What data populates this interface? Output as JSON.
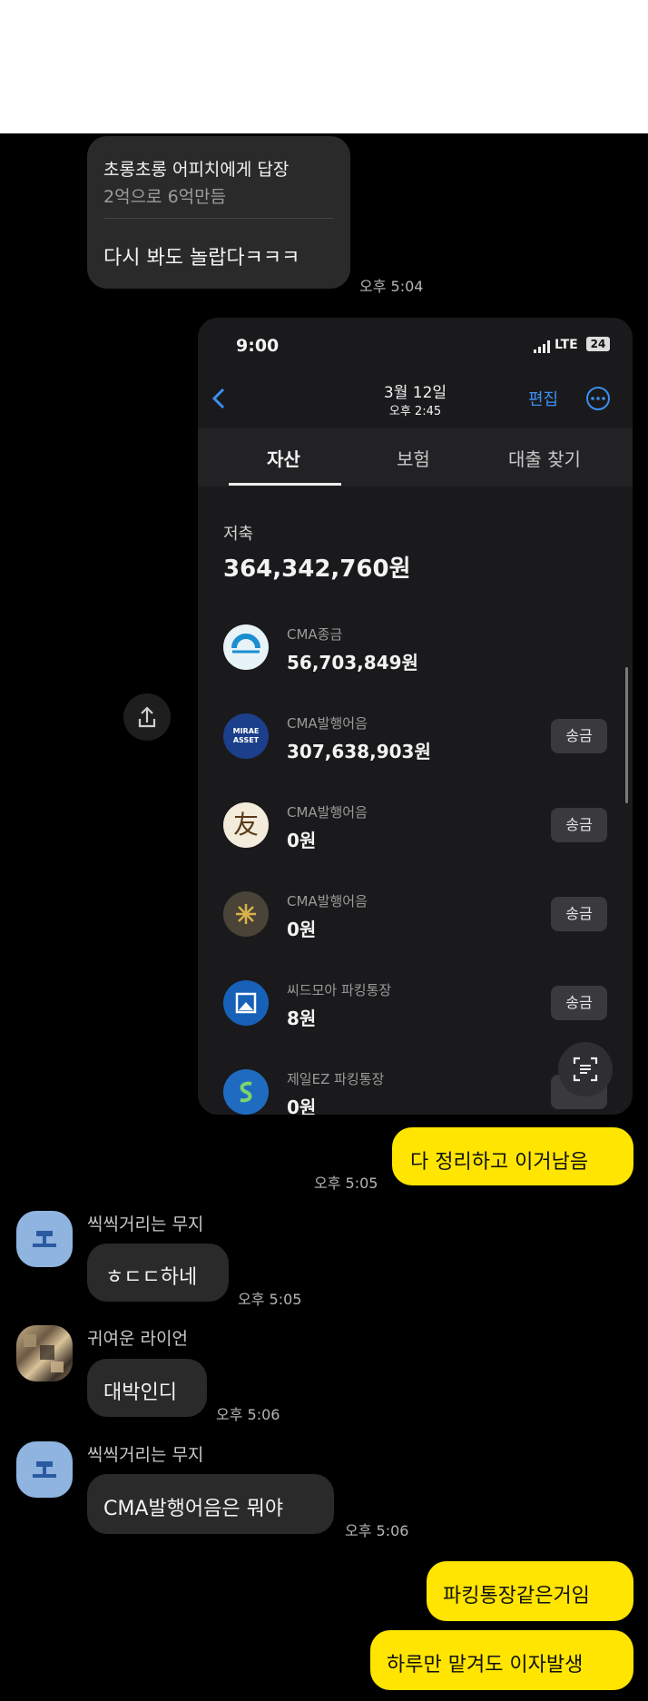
{
  "messages": {
    "reply": {
      "title": "초롱초롱 어피치에게 답장",
      "quote": "2억으로 6억만듬",
      "text": "다시 봐도 놀랍다ㅋㅋㅋ",
      "time": "오후 5:04"
    },
    "mine1": {
      "text": "다 정리하고 이거남음",
      "time": "오후 5:05"
    },
    "muji1": {
      "name": "씩씩거리는 무지",
      "text": "ㅎㄷㄷ하네",
      "time": "오후 5:05"
    },
    "ryan": {
      "name": "귀여운 라이언",
      "text": "대박인디",
      "time": "오후 5:06"
    },
    "muji2": {
      "name": "씩씩거리는 무지",
      "text": "CMA발행어음은 뭐야",
      "time": "오후 5:06"
    },
    "mine2": {
      "text": "파킹통장같은거임"
    },
    "mine3": {
      "text": "하루만 맡겨도 이자발생"
    }
  },
  "screenshot": {
    "status_time": "9:00",
    "network": "LTE",
    "battery": "24",
    "date": "3월 12일",
    "date_time": "오후 2:45",
    "edit": "편집",
    "tabs": [
      "자산",
      "보험",
      "대출 찾기"
    ],
    "section_label": "저축",
    "section_total": "364,342,760원",
    "send_label": "송금",
    "accounts": [
      {
        "name": "CMA종금",
        "amount": "56,703,849원",
        "icon_color": "#e8f3f7"
      },
      {
        "name": "CMA발행어음",
        "amount": "307,638,903원",
        "icon_color": "#1c3f8c",
        "icon_text": "MIRAE ASSET"
      },
      {
        "name": "CMA발행어음",
        "amount": "0원",
        "icon_color": "#f3ecdc",
        "icon_text": "友"
      },
      {
        "name": "CMA발행어음",
        "amount": "0원",
        "icon_color": "#4a4338"
      },
      {
        "name": "씨드모아 파킹통장",
        "amount": "8원",
        "icon_color": "#1761b8"
      },
      {
        "name": "제일EZ 파킹통장",
        "amount": "0원",
        "icon_color": "#1f6bc0"
      }
    ]
  },
  "colors": {
    "yellow": "#ffe500",
    "bubble_dark": "#2a2a2a",
    "link_blue": "#3b8ff0"
  }
}
